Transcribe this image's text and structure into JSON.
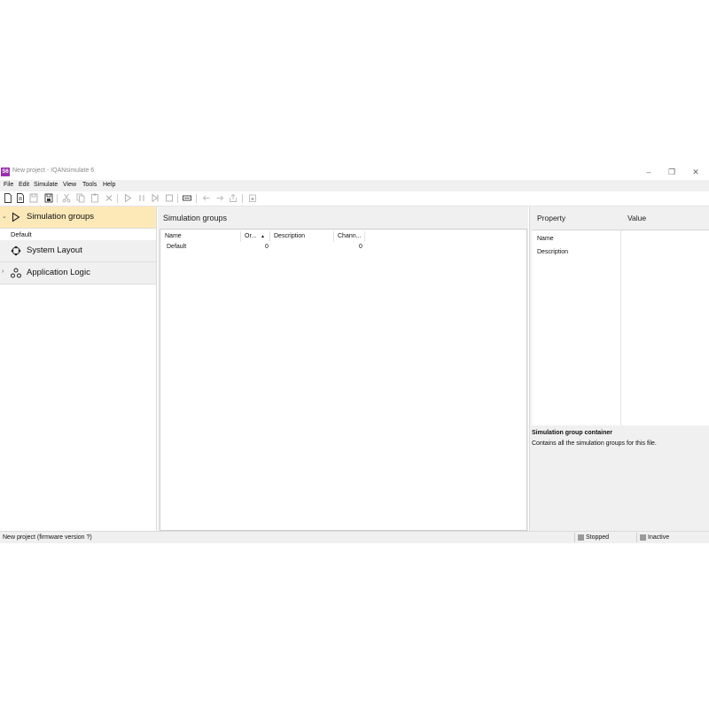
{
  "window": {
    "app_icon": "S6",
    "title": "New project - IQANsimulate 6",
    "controls": {
      "minimize": "–",
      "maximize": "❐",
      "close": "✕"
    }
  },
  "menu": [
    "File",
    "Edit",
    "Simulate",
    "View",
    "Tools",
    "Help"
  ],
  "toolbar_icons": [
    "new-file-icon",
    "open-file-icon",
    "save-icon",
    "save-as-icon",
    "cut-icon",
    "copy-icon",
    "paste-icon",
    "delete-icon",
    "play-icon",
    "pause-icon",
    "step-icon",
    "stop-icon",
    "fit-icon",
    "undo-icon",
    "redo-icon",
    "export-icon",
    "import-icon"
  ],
  "sidebar": {
    "items": [
      {
        "label": "Simulation groups",
        "icon": "play-outline-icon",
        "expanded": true
      },
      {
        "label": "System Layout",
        "icon": "network-ring-icon"
      },
      {
        "label": "Application Logic",
        "icon": "logic-nodes-icon"
      }
    ],
    "sub_items": [
      "Default"
    ]
  },
  "center": {
    "title": "Simulation groups",
    "columns": [
      "Name",
      "Or...",
      "Description",
      "Chann..."
    ],
    "sort_indicator": "▲",
    "rows": [
      {
        "name": "Default",
        "order": "0",
        "description": "",
        "channels": "0"
      }
    ]
  },
  "properties": {
    "headers": {
      "property": "Property",
      "value": "Value"
    },
    "rows": [
      "Name",
      "Description"
    ],
    "description_title": "Simulation group container",
    "description_text": "Contains all the simulation groups for this file."
  },
  "status": {
    "left": "New project (firmware version ?)",
    "sim_state": "Stopped",
    "connection": "Inactive"
  }
}
